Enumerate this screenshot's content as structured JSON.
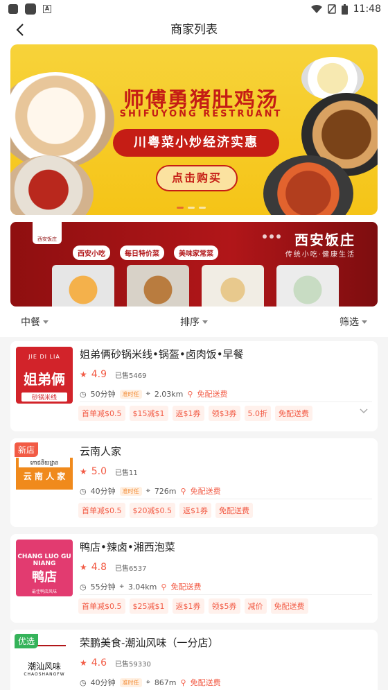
{
  "status_bar": {
    "time": "11:48"
  },
  "header": {
    "title": "商家列表"
  },
  "banner": {
    "title": "师傅勇猪肚鸡汤",
    "subtitle": "SHIFUYONG RESTRUANT",
    "slogan": "川粤菜小炒经济实惠",
    "button": "点击购买"
  },
  "banner2": {
    "logo_text": "西安饭庄",
    "title": "西安饭庄",
    "subtitle": "传统小吃·健康生活",
    "tags": [
      "西安小吃",
      "每日特价菜",
      "美味家常菜"
    ]
  },
  "filters": {
    "category": "中餐",
    "sort": "排序",
    "filter": "筛选"
  },
  "shops": [
    {
      "name": "姐弟俩砂锅米线•锅盔•卤肉饭•早餐",
      "logo_top": "JIE DI LIA",
      "logo_main": "姐弟俩",
      "logo_sub": "砂锅米线",
      "rating": "4.9",
      "sold": "已售5469",
      "time": "50分钟",
      "time_tag": "准时任",
      "distance": "2.03km",
      "delivery": "免配送费",
      "promos": [
        "首单减$0.5",
        "$15减$1",
        "返$1券",
        "领$3券",
        "5.0折",
        "免配送费"
      ]
    },
    {
      "name": "云南人家",
      "badge": "新店",
      "logo_khmer": "ភោជនីយដ្ឋាន",
      "logo_main": "云 南 人 家",
      "rating": "5.0",
      "sold": "已售11",
      "time": "40分钟",
      "time_tag": "准时任",
      "distance": "726m",
      "delivery": "免配送费",
      "promos": [
        "首单减$0.5",
        "$20减$0.5",
        "返$1券",
        "免配送费"
      ]
    },
    {
      "name": "鸭店•辣卤•湘西泡菜",
      "logo_en": "CHANG LUO GU NIANG",
      "logo_main": "鸭店",
      "logo_small": "最佳鸭店风味",
      "rating": "4.8",
      "sold": "已售6537",
      "time": "55分钟",
      "distance": "3.04km",
      "delivery": "免配送费",
      "promos": [
        "首单减$0.5",
        "$25减$1",
        "返$1券",
        "领$5券",
        "减价",
        "免配送费"
      ]
    },
    {
      "name": "荣鹏美食-潮汕风味（一分店）",
      "badge": "优选",
      "logo_main": "潮汕风味",
      "logo_en": "CHAOSHANGFW",
      "rating": "4.6",
      "sold": "已售59330",
      "time": "40分钟",
      "time_tag": "准时任",
      "distance": "867m",
      "delivery": "免配送费"
    }
  ]
}
